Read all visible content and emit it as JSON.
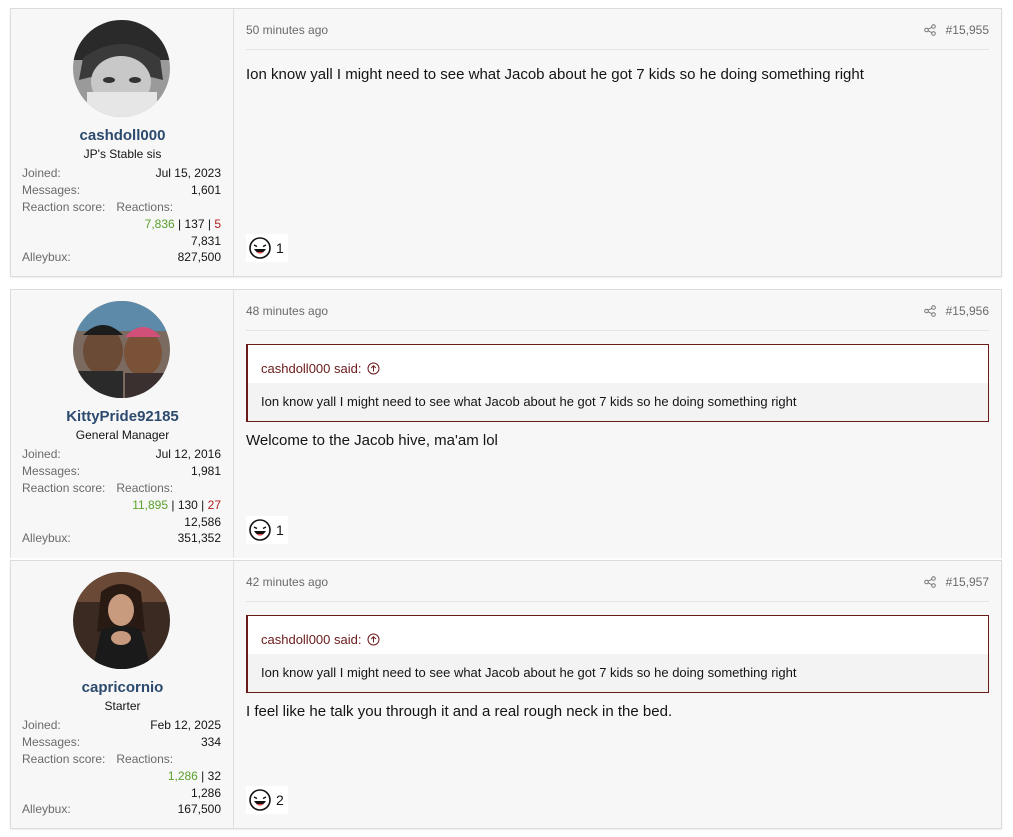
{
  "posts": [
    {
      "username": "cashdoll000",
      "user_title": "JP's Stable sis",
      "joined_label": "Joined:",
      "joined": "Jul 15, 2023",
      "messages_label": "Messages:",
      "messages": "1,601",
      "reaction_score_label": "Reaction score:",
      "reactions_label": "Reactions:",
      "rx_positive": "7,836",
      "rx_neutral": "137",
      "rx_negative": "5",
      "reaction_score": "7,831",
      "alleybux_label": "Alleybux:",
      "alleybux": "827,500",
      "time": "50 minutes ago",
      "post_number": "#15,955",
      "message": "Ion know yall I might need to see what Jacob about he got 7 kids so he doing something right",
      "reaction_count": "1"
    },
    {
      "username": "KittyPride92185",
      "user_title": "General Manager",
      "joined_label": "Joined:",
      "joined": "Jul 12, 2016",
      "messages_label": "Messages:",
      "messages": "1,981",
      "reaction_score_label": "Reaction score:",
      "reactions_label": "Reactions:",
      "rx_positive": "11,895",
      "rx_neutral": "130",
      "rx_negative": "27",
      "reaction_score": "12,586",
      "alleybux_label": "Alleybux:",
      "alleybux": "351,352",
      "time": "48 minutes ago",
      "post_number": "#15,956",
      "quote_author": "cashdoll000 said:",
      "quote_text": "Ion know yall I might need to see what Jacob about he got 7 kids so he doing something right",
      "message": "Welcome to the Jacob hive, ma'am lol",
      "reaction_count": "1"
    },
    {
      "username": "capricornio",
      "user_title": "Starter",
      "joined_label": "Joined:",
      "joined": "Feb 12, 2025",
      "messages_label": "Messages:",
      "messages": "334",
      "reaction_score_label": "Reaction score:",
      "reactions_label": "Reactions:",
      "rx_positive": "1,286",
      "rx_neutral": "32",
      "reaction_score": "1,286",
      "alleybux_label": "Alleybux:",
      "alleybux": "167,500",
      "time": "42 minutes ago",
      "post_number": "#15,957",
      "quote_author": "cashdoll000 said:",
      "quote_text": "Ion know yall I might need to see what Jacob about he got 7 kids so he doing something right",
      "message": "I feel like he talk you through it and a real rough neck in the bed.",
      "reaction_count": "2"
    }
  ],
  "icons": {
    "share": "share-icon",
    "quote_jump": "arrow-up-circle-icon",
    "reaction": "laughing-emoji-icon"
  },
  "colors": {
    "username": "#2c4a6e",
    "positive": "#5aa02c",
    "negative": "#b01e1e",
    "quote_border": "#6b1a1a"
  }
}
